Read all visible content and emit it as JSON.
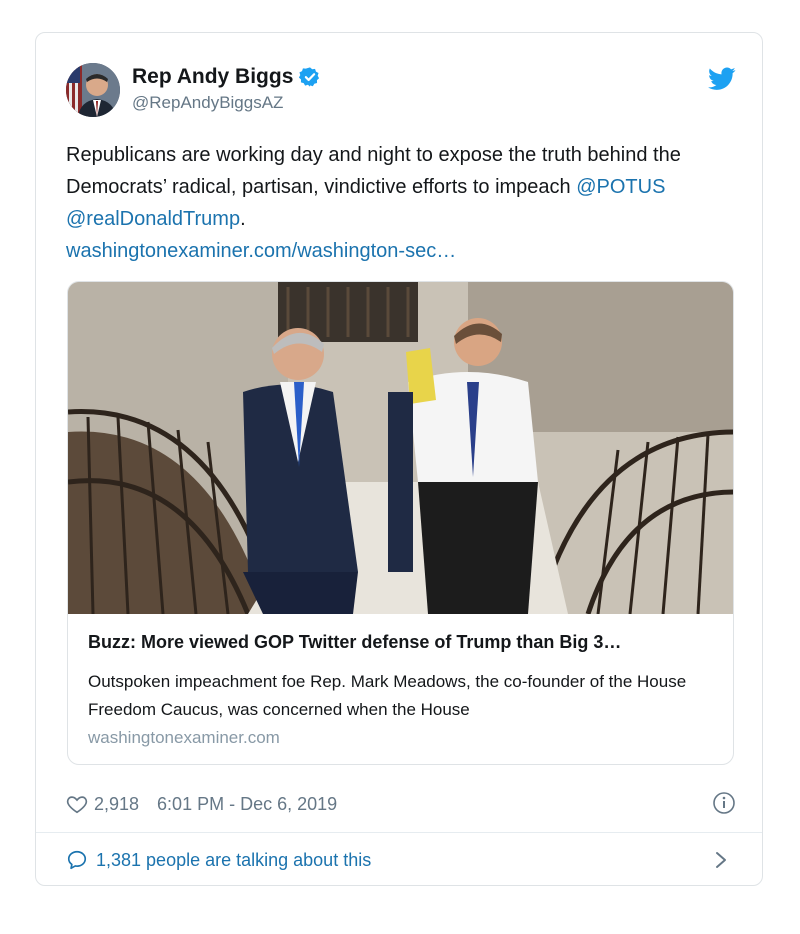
{
  "tweet": {
    "author": {
      "name": "Rep Andy Biggs",
      "handle": "@RepAndyBiggsAZ"
    },
    "text": {
      "part1": "Republicans are working day and night to expose the truth behind the Democrats’ radical, partisan, vindictive efforts to impeach ",
      "mention1": "@POTUS",
      "mention2": "@realDonaldTrump",
      "end": ".",
      "link": "washingtonexaminer.com/washington-sec…"
    },
    "link_card": {
      "title": "Buzz: More viewed GOP Twitter defense of Trump than Big 3…",
      "description": "Outspoken impeachment foe Rep. Mark Meadows, the co-founder of the House Freedom Caucus, was concerned when the House",
      "domain": "washingtonexaminer.com"
    },
    "likes": "2,918",
    "timestamp": "6:01 PM - Dec 6, 2019",
    "talking": "1,381 people are talking about this"
  },
  "colors": {
    "link_blue": "#1b73ae",
    "twitter_blue": "#1da1f2",
    "muted": "#657786"
  },
  "icons": [
    "verified-badge-icon",
    "twitter-bird-icon",
    "heart-icon",
    "info-icon",
    "comment-bubble-icon",
    "chevron-right-icon"
  ]
}
